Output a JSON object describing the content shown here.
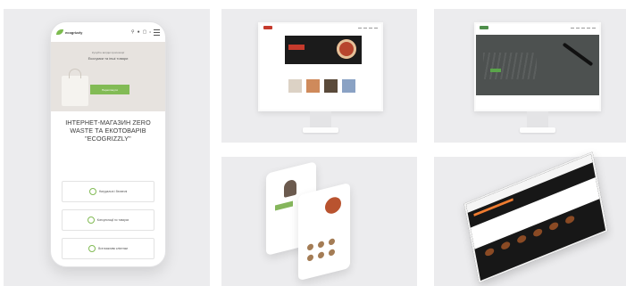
{
  "gallery": {
    "phone_mockup": {
      "logo_text": "ecogrizzly",
      "cart_count": "0",
      "hero_subtitle": "Купуйте вигідні пропозиції",
      "hero_title": "Екосумки та інші товари",
      "hero_button": "Переглянути",
      "heading": "ІНТЕРНЕТ-МАГАЗИН ZERO WASTE ТА ЕКОТОВАРІВ \"ECOGRIZZLY\"",
      "features": [
        {
          "icon": "leaf-icon",
          "label": "Натуральні і безпечні"
        },
        {
          "icon": "support-icon",
          "label": "Консультації по товарах"
        },
        {
          "icon": "phone-icon",
          "label": "Все важливо клієнтам"
        }
      ]
    },
    "desktop_mockups": [
      {
        "theme": "food-delivery",
        "accent": "#c53a2c"
      },
      {
        "theme": "corporate",
        "accent": "#5aa54a"
      }
    ],
    "mobile_mockups": {
      "accent": "#85b65c"
    },
    "laptop_mockup": {
      "accent": "#f07c30"
    }
  }
}
